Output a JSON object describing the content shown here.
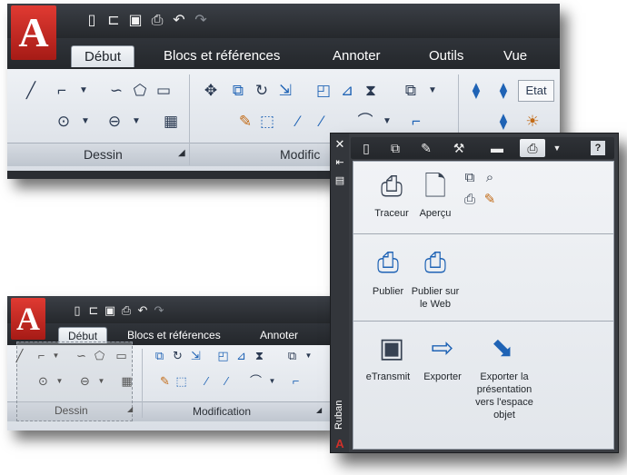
{
  "top_ribbon": {
    "tabs": [
      "Début",
      "Blocs et références",
      "Annoter",
      "Outils",
      "Vue"
    ],
    "active_tab": "Début",
    "panel_labels": {
      "draw": "Dessin",
      "modify": "Modific"
    },
    "clipped_control": "Etat",
    "qat_icons": [
      "new-icon",
      "open-icon",
      "save-icon",
      "print-icon",
      "undo-icon",
      "redo-icon"
    ]
  },
  "bottom_ribbon": {
    "tabs": [
      "Début",
      "Blocs et références",
      "Annoter"
    ],
    "active_tab": "Début",
    "panel_labels": {
      "draw": "Dessin",
      "modify": "Modification"
    }
  },
  "palette": {
    "side_label": "Ruban",
    "side_buttons": [
      "close-icon",
      "pin-icon",
      "properties-icon"
    ],
    "tab_icons": [
      "document-icon",
      "layers-icon",
      "brush-icon",
      "wrench-icon",
      "monitor-icon",
      "printer-icon",
      "help-icon"
    ],
    "help_label": "?",
    "groups": [
      {
        "items": [
          {
            "label": "Traceur",
            "icon": "plotter-icon"
          },
          {
            "label": "Aperçu",
            "icon": "preview-icon"
          }
        ]
      },
      {
        "items": [
          {
            "label": "Publier",
            "icon": "publish-icon"
          },
          {
            "label": "Publier sur\nle Web",
            "icon": "publish-web-icon"
          }
        ]
      },
      {
        "items": [
          {
            "label": "eTransmit",
            "icon": "etransmit-icon"
          },
          {
            "label": "Exporter",
            "icon": "export-icon"
          },
          {
            "label": "Exporter la\nprésentation\nvers l'espace\nobjet",
            "icon": "export-layout-icon"
          }
        ]
      }
    ]
  },
  "colors": {
    "dark_chrome": "#2a2d32",
    "panel_light": "#eef1f5",
    "logo_red": "#d0302a",
    "accent_blue": "#1f63b5"
  }
}
